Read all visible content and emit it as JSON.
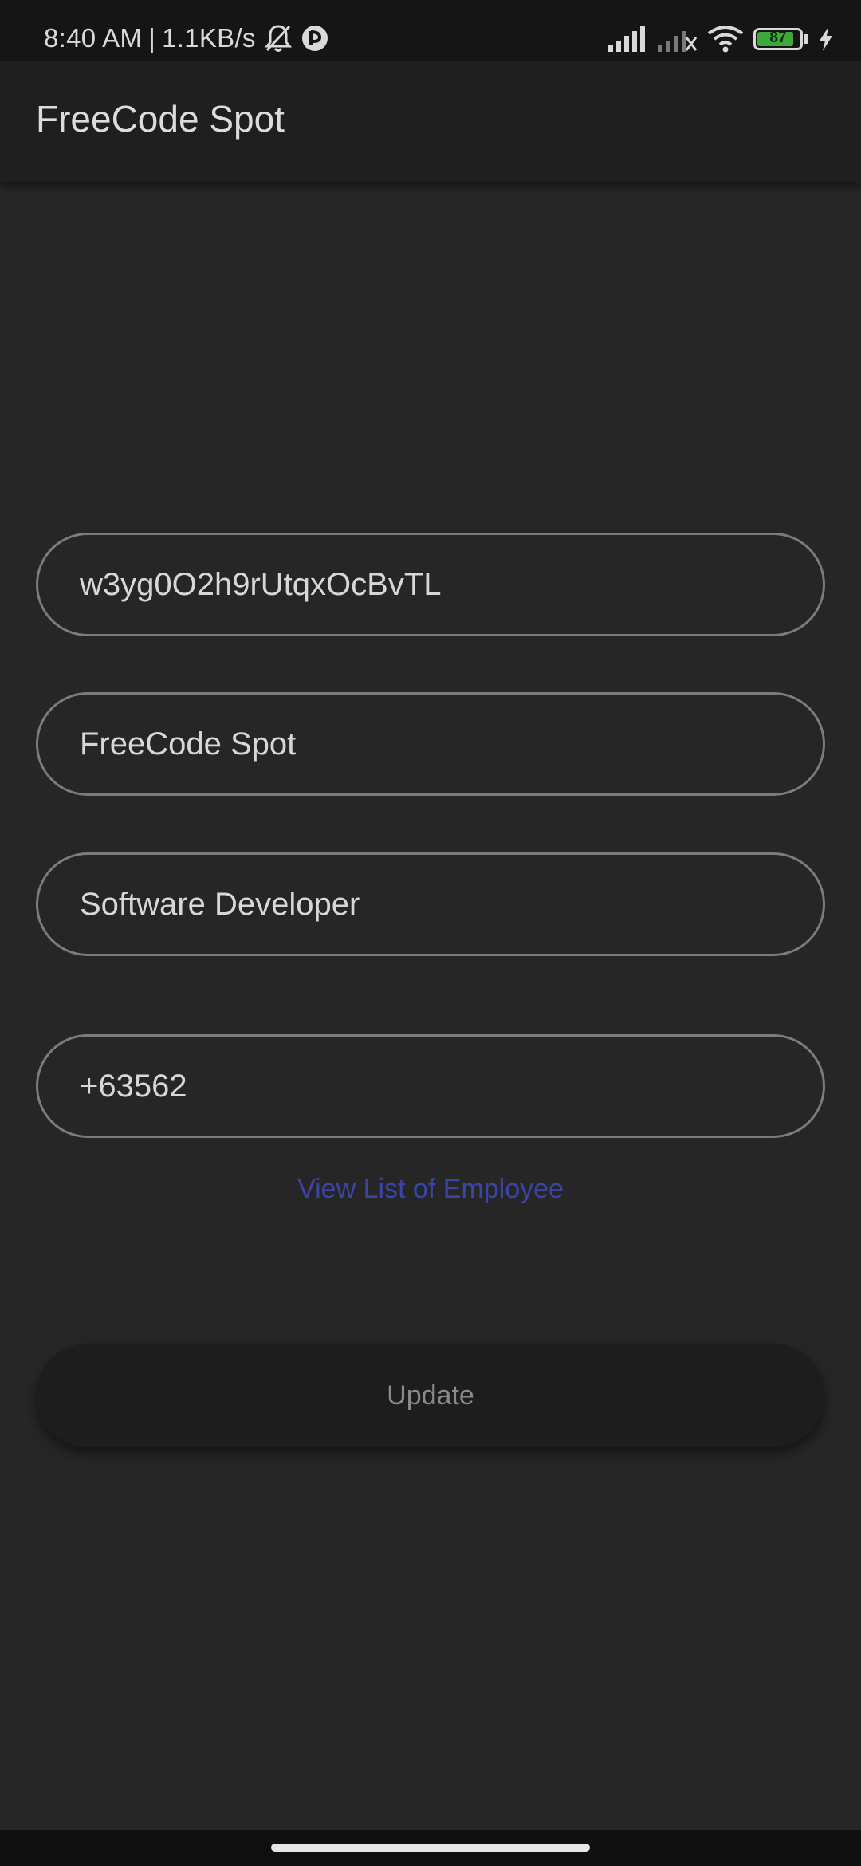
{
  "status_bar": {
    "time": "8:40 AM",
    "separator": "|",
    "network_speed": "1.1KB/s",
    "battery_level": "87",
    "icons": [
      "bell-off-icon",
      "app-notification-icon",
      "signal-icon",
      "signal-no-sim-icon",
      "wifi-icon",
      "battery-icon",
      "charging-bolt-icon"
    ]
  },
  "app_bar": {
    "title": "FreeCode Spot"
  },
  "form": {
    "field_id": "w3yg0O2h9rUtqxOcBvTL",
    "field_name": "FreeCode Spot",
    "field_position": "Software Developer",
    "field_contact": "+63562"
  },
  "link": {
    "view_list": "View List of Employee"
  },
  "button": {
    "update": "Update"
  },
  "colors": {
    "background": "#262626",
    "app_bar": "#1f1f1f",
    "link": "#3a45a6",
    "field_border": "#7b7b7b",
    "battery_fill": "#3fa83a"
  }
}
